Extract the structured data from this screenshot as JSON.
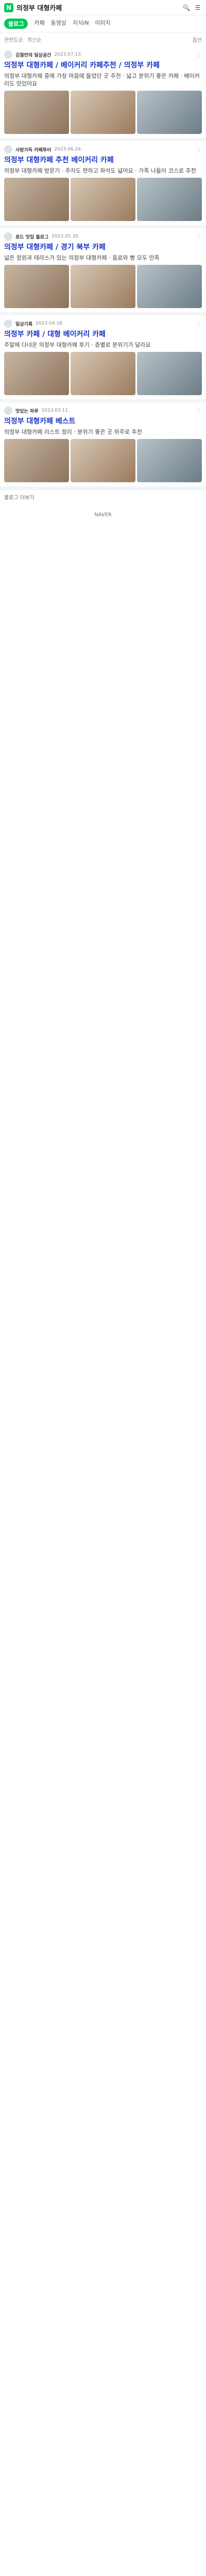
{
  "header": {
    "logo": "N",
    "query": "의정부 대형카페"
  },
  "tabs": [
    {
      "label": "블로그"
    },
    {
      "label": "카페"
    },
    {
      "label": "동영상"
    },
    {
      "label": "지식iN"
    },
    {
      "label": "이미지"
    }
  ],
  "filters": {
    "left": [
      "관련도순",
      "최신순"
    ],
    "right": "옵션"
  },
  "posts": [
    {
      "blog": "김철연의 일상공간",
      "date": "2023.07.13.",
      "title": "의정부 대형카페 / 베이커리 카페추천 / 의정부 카페",
      "desc": "의정부 대형카페 중에 가장 마음에 들었던 곳 추천 · 넓고 분위기 좋은 카페 · 베이커리도 맛있어요"
    },
    {
      "blog": "사랑가득 카페투어",
      "date": "2023.06.24.",
      "title": "의정부 대형카페 추천 베이커리 카페",
      "desc": "의정부 대형카페 방문기 · 주차도 편하고 좌석도 넓어요 · 가족 나들이 코스로 추천"
    },
    {
      "blog": "로드 맛집 블로그",
      "date": "2023.05.30.",
      "title": "의정부 대형카페 / 경기 북부 카페",
      "desc": "넓은 정원과 테라스가 있는 의정부 대형카페 · 음료와 빵 모두 만족"
    },
    {
      "blog": "일상기록",
      "date": "2023.04.18.",
      "title": "의정부 카페 / 대형 베이커리 카페",
      "desc": "주말에 다녀온 의정부 대형카페 후기 · 층별로 분위기가 달라요"
    },
    {
      "blog": "맛있는 하루",
      "date": "2023.03.11.",
      "title": "의정부 대형카페 베스트",
      "desc": "의정부 대형카페 리스트 정리 · 분위기 좋은 곳 위주로 추천"
    }
  ],
  "more": "블로그 더보기",
  "footer": "NAVER"
}
